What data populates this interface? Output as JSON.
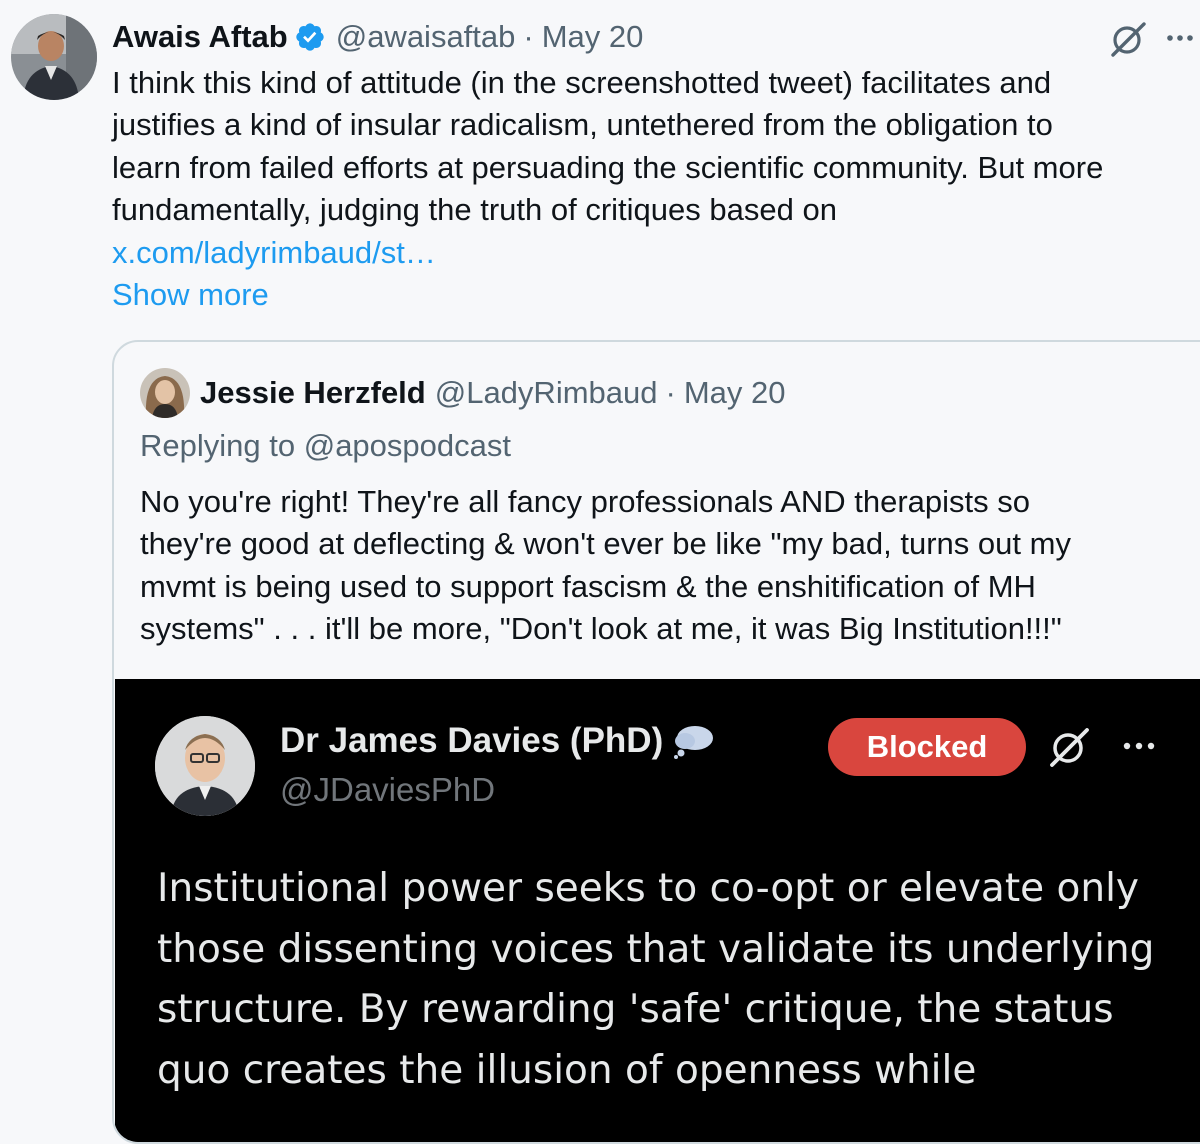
{
  "tweet": {
    "author_name": "Awais Aftab",
    "handle": "@awaisaftab",
    "separator": "·",
    "date": "May 20",
    "text_lines": [
      "I think this kind of attitude (in the screenshotted tweet) facilitates and",
      "justifies a kind of insular radicalism, untethered from the obligation to",
      "learn from failed efforts at persuading the scientific community. But more",
      "fundamentally, judging the truth of critiques based on"
    ],
    "link_text": "x.com/ladyrimbaud/st…",
    "show_more": "Show more",
    "icons": {
      "verified": "verified-badge-icon",
      "grok": "grok-icon",
      "more": "more-icon"
    },
    "colors": {
      "link": "#1d9bf0",
      "verified": "#1d9bf0",
      "muted": "#536471"
    }
  },
  "quoted": {
    "author_name": "Jessie Herzfeld",
    "handle": "@LadyRimbaud",
    "separator": "·",
    "date": "May 20",
    "replying_prefix": "Replying to ",
    "replying_handle": "@apospodcast",
    "text_lines": [
      "No you're right! They're all fancy professionals AND therapists so",
      "they're good at deflecting & won't ever be like \"my bad, turns out my",
      "mvmt is being used to support fascism & the enshitification of MH",
      "systems\" . . . it'll be more, \"Don't look at me, it was Big Institution!!!\""
    ]
  },
  "screenshot": {
    "author_name": "Dr James Davies (PhD)",
    "handle": "@JDaviesPhD",
    "blocked_label": "Blocked",
    "text_lines": [
      "Institutional power seeks to co-opt or elevate only",
      "those dissenting voices that validate its underlying",
      "structure. By rewarding 'safe' critique, the status",
      "quo creates the illusion of openness while"
    ],
    "colors": {
      "background": "#000000",
      "blocked": "#d9463e",
      "text": "#e7e9ea",
      "muted": "#71767b"
    }
  }
}
